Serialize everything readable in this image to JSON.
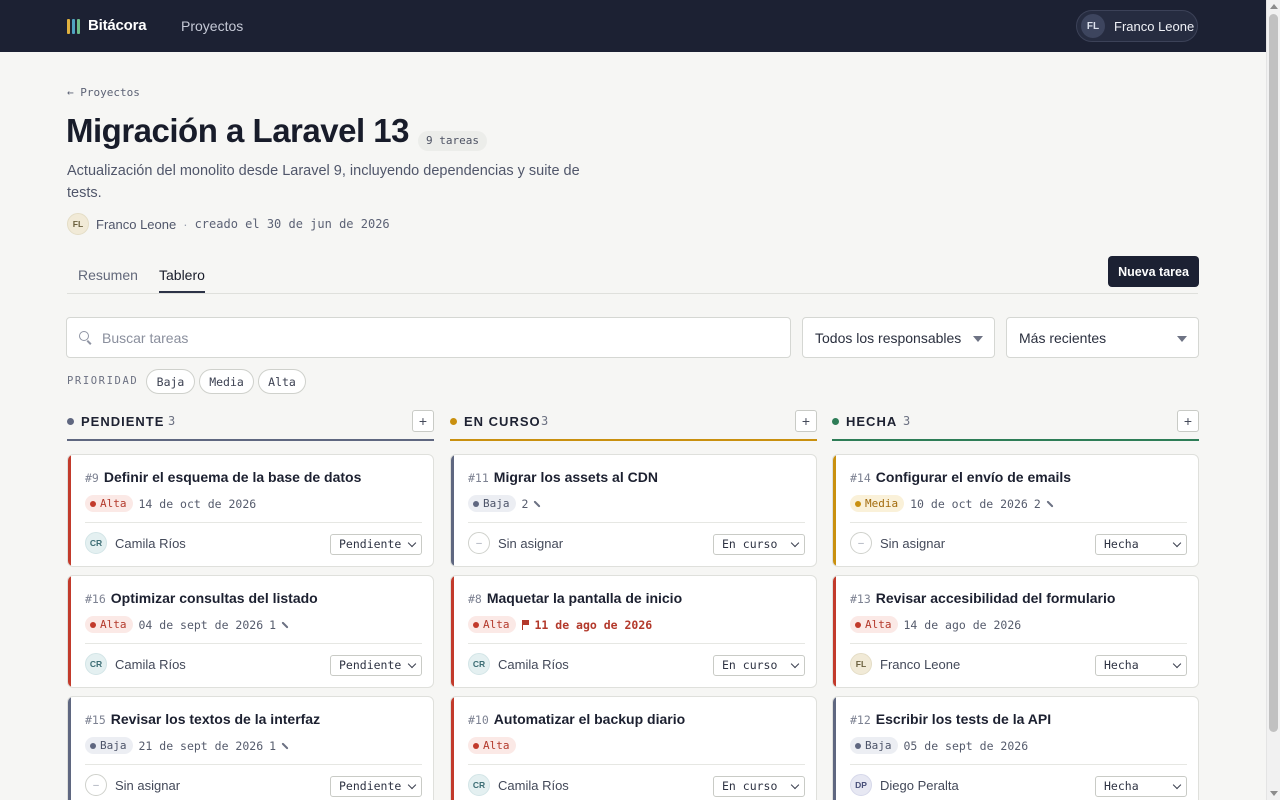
{
  "nav": {
    "brand": "Bitácora",
    "link": "Proyectos",
    "user": {
      "initials": "FL",
      "name": "Franco Leone"
    }
  },
  "header": {
    "back": "← Proyectos",
    "title": "Migración a Laravel 13",
    "count": "9 tareas",
    "description": "Actualización del monolito desde Laravel 9, incluyendo dependencias y suite de tests.",
    "owner_initials": "FL",
    "owner": "Franco Leone",
    "sep": "·",
    "created": "creado el 30 de jun de 2026"
  },
  "tabs": [
    "Resumen",
    "Tablero"
  ],
  "new_task": "Nueva tarea",
  "filters": {
    "search_placeholder": "Buscar tareas",
    "assignee": "Todos los responsables",
    "sort": "Más recientes",
    "priority_label": "PRIORIDAD",
    "priorities": [
      "Baja",
      "Media",
      "Alta"
    ]
  },
  "colors": {
    "alta": "#c23a2b",
    "media": "#c9900f",
    "baja": "#5f6780",
    "pendiente": "#5f6780",
    "en_curso": "#c9900f",
    "hecha": "#2e7d57"
  },
  "columns": [
    {
      "name": "PENDIENTE",
      "count": "3",
      "add": "+",
      "cards": [
        {
          "id": "#9",
          "title": "Definir el esquema de la base de datos",
          "priority": "Alta",
          "due": "14 de oct de 2026",
          "comments": "",
          "assignee_initials": "CR",
          "assignee": "Camila Ríos",
          "status": "Pendiente"
        },
        {
          "id": "#16",
          "title": "Optimizar consultas del listado",
          "priority": "Alta",
          "due": "04 de sept de 2026",
          "comments": "1",
          "assignee_initials": "CR",
          "assignee": "Camila Ríos",
          "status": "Pendiente"
        },
        {
          "id": "#15",
          "title": "Revisar los textos de la interfaz",
          "priority": "Baja",
          "due": "21 de sept de 2026",
          "comments": "1",
          "assignee_initials": "–",
          "assignee": "Sin asignar",
          "status": "Pendiente"
        }
      ]
    },
    {
      "name": "EN CURSO",
      "count": "3",
      "add": "+",
      "cards": [
        {
          "id": "#11",
          "title": "Migrar los assets al CDN",
          "priority": "Baja",
          "due": "",
          "comments": "2",
          "assignee_initials": "–",
          "assignee": "Sin asignar",
          "status": "En curso"
        },
        {
          "id": "#8",
          "title": "Maquetar la pantalla de inicio",
          "priority": "Alta",
          "due": "11 de ago de 2026",
          "comments": "",
          "assignee_initials": "CR",
          "assignee": "Camila Ríos",
          "status": "En curso"
        },
        {
          "id": "#10",
          "title": "Automatizar el backup diario",
          "priority": "Alta",
          "due": "",
          "comments": "",
          "assignee_initials": "CR",
          "assignee": "Camila Ríos",
          "status": "En curso"
        }
      ]
    },
    {
      "name": "HECHA",
      "count": "3",
      "add": "+",
      "cards": [
        {
          "id": "#14",
          "title": "Configurar el envío de emails",
          "priority": "Media",
          "due": "10 de oct de 2026",
          "comments": "2",
          "assignee_initials": "–",
          "assignee": "Sin asignar",
          "status": "Hecha"
        },
        {
          "id": "#13",
          "title": "Revisar accesibilidad del formulario",
          "priority": "Alta",
          "due": "14 de ago de 2026",
          "comments": "",
          "assignee_initials": "FL",
          "assignee": "Franco Leone",
          "status": "Hecha"
        },
        {
          "id": "#12",
          "title": "Escribir los tests de la API",
          "priority": "Baja",
          "due": "05 de sept de 2026",
          "comments": "",
          "assignee_initials": "DP",
          "assignee": "Diego Peralta",
          "status": "Hecha"
        }
      ]
    }
  ]
}
